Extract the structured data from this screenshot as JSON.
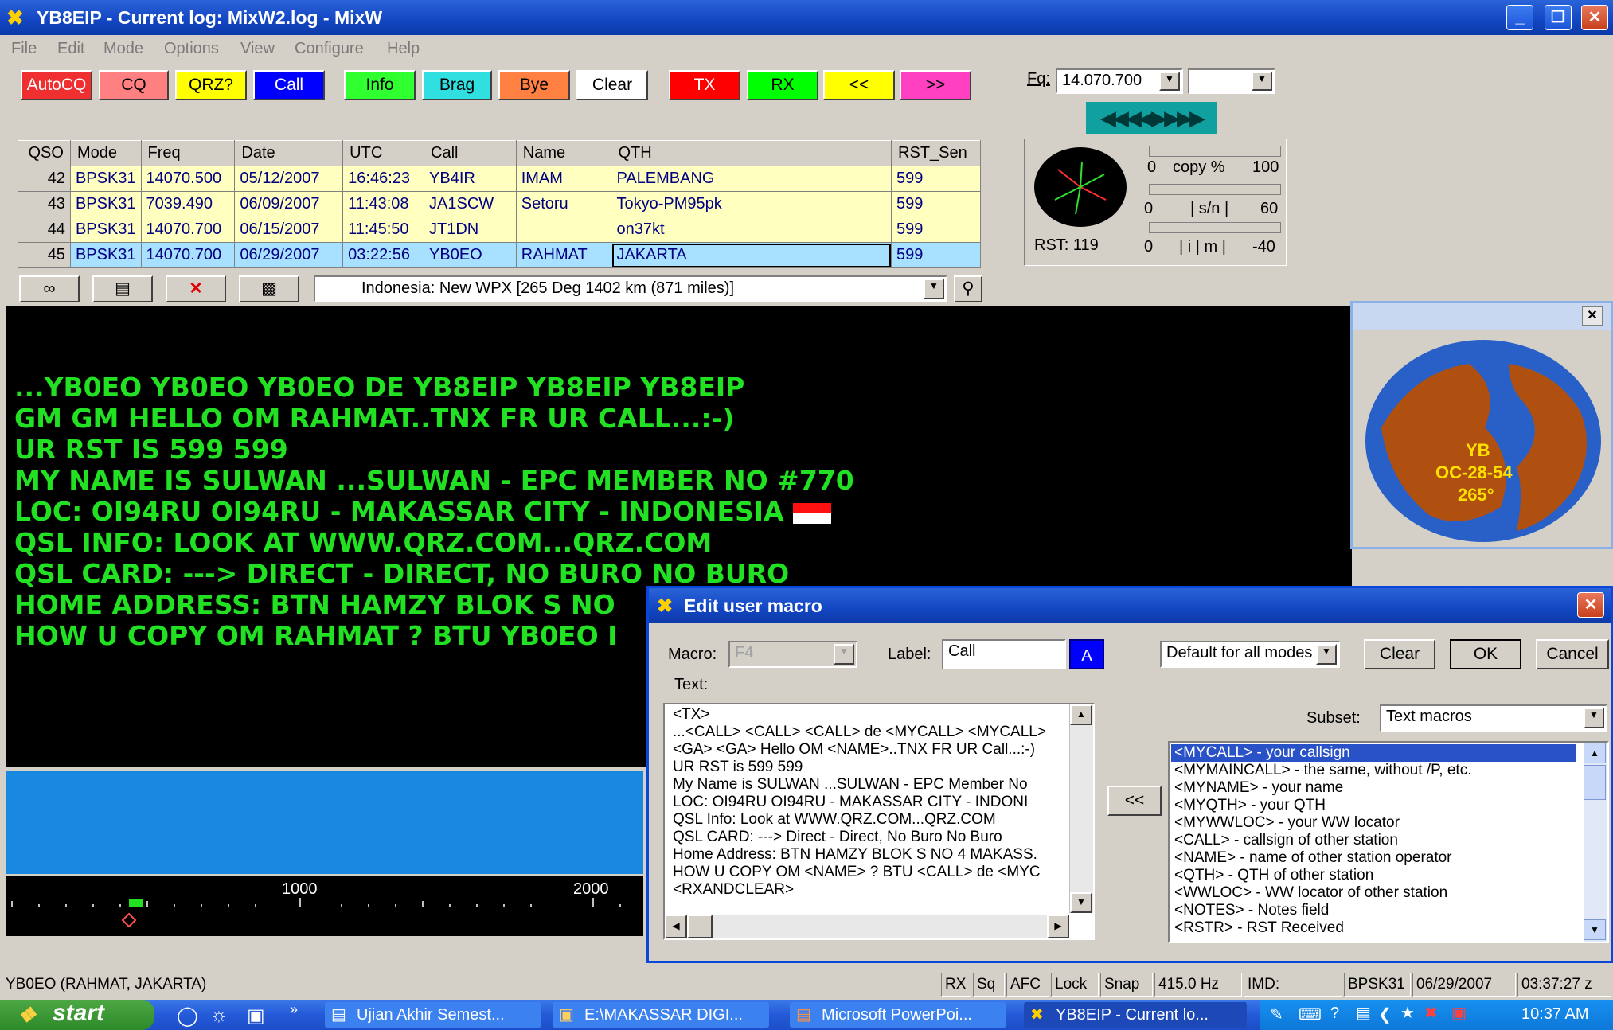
{
  "window": {
    "title": "YB8EIP - Current log: MixW2.log - MixW"
  },
  "menu": [
    "File",
    "Edit",
    "Mode",
    "Options",
    "View",
    "Configure",
    "Help"
  ],
  "macro_buttons": [
    {
      "label": "AutoCQ",
      "bg": "#f03030",
      "fg": "#ffffff"
    },
    {
      "label": "CQ",
      "bg": "#ff8080",
      "fg": "#000000"
    },
    {
      "label": "QRZ?",
      "bg": "#ffff00",
      "fg": "#000000"
    },
    {
      "label": "Call",
      "bg": "#0000ff",
      "fg": "#ffffff"
    },
    {
      "label": "Info",
      "bg": "#30ff30",
      "fg": "#000000"
    },
    {
      "label": "Brag",
      "bg": "#30e0e0",
      "fg": "#000000"
    },
    {
      "label": "Bye",
      "bg": "#ff8040",
      "fg": "#000000"
    },
    {
      "label": "Clear",
      "bg": "#ffffff",
      "fg": "#000000"
    },
    {
      "label": "TX",
      "bg": "#ff0000",
      "fg": "#ffffff"
    },
    {
      "label": "RX",
      "bg": "#00ff00",
      "fg": "#000000"
    },
    {
      "label": "<<",
      "bg": "#ffff00",
      "fg": "#000000"
    },
    {
      "label": ">>",
      "bg": "#ff40c0",
      "fg": "#000000"
    }
  ],
  "frequency": {
    "label": "Fq:",
    "value": "14.070.700",
    "second_value": ""
  },
  "tuning": {
    "copy_min": "0",
    "copy_label": "copy %",
    "copy_max": "100",
    "sn_min": "0",
    "sn_label": "| s/n |",
    "sn_max": "60",
    "imd_min": "0",
    "imd_label": "| i | m |",
    "imd_max": "-40",
    "rst": "RST: 119"
  },
  "log": {
    "headers": [
      "QSO",
      "Mode",
      "Freq",
      "Date",
      "UTC",
      "Call",
      "Name",
      "QTH",
      "RST_Sen"
    ],
    "rows": [
      [
        "42",
        "BPSK31",
        "14070.500",
        "05/12/2007",
        "16:46:23",
        "YB4IR",
        "IMAM",
        "PALEMBANG",
        "599"
      ],
      [
        "43",
        "BPSK31",
        "7039.490",
        "06/09/2007",
        "11:43:08",
        "JA1SCW",
        "Setoru",
        "Tokyo-PM95pk",
        "599"
      ],
      [
        "44",
        "BPSK31",
        "14070.700",
        "06/15/2007",
        "11:45:50",
        "JT1DN",
        "",
        "on37kt",
        "599"
      ],
      [
        "45",
        "BPSK31",
        "14070.700",
        "06/29/2007",
        "03:22:56",
        "YB0EO",
        "RAHMAT",
        "JAKARTA",
        "599"
      ]
    ]
  },
  "lookup": {
    "text": "Indonesia:  New WPX [265 Deg  1402 km (871 miles)]"
  },
  "terminal_lines": [
    "...YB0EO YB0EO YB0EO DE YB8EIP YB8EIP  YB8EIP",
    "GM GM HELLO OM RAHMAT..TNX FR UR CALL...:-)",
    "UR RST IS 599 599",
    "MY NAME IS SULWAN ...SULWAN - EPC MEMBER NO #770",
    "LOC: OI94RU  OI94RU  - MAKASSAR CITY - INDONESIA",
    "QSL INFO: LOOK AT  WWW.QRZ.COM...QRZ.COM",
    "QSL CARD: ---> DIRECT - DIRECT, NO BURO NO BURO",
    "HOME ADDRESS: BTN HAMZY BLOK S NO",
    "HOW U COPY OM RAHMAT ? BTU YB0EO I"
  ],
  "scale": {
    "mark1": "1000",
    "mark2": "2000"
  },
  "map": {
    "prefix": "YB",
    "zones": "OC-28-54",
    "bearing": "265°"
  },
  "dialog": {
    "title": "Edit user macro",
    "macro_label": "Macro:",
    "macro_value": "F4",
    "label_label": "Label:",
    "label_value": "Call",
    "color_btn": "A",
    "mode_value": "Default for all modes",
    "clear": "Clear",
    "ok": "OK",
    "cancel": "Cancel",
    "text_label": "Text:",
    "subset_label": "Subset:",
    "subset_value": "Text macros",
    "insert_btn": "<<",
    "text_lines": [
      "<TX>",
      "...<CALL> <CALL> <CALL> de <MYCALL> <MYCALL>",
      "<GA> <GA> Hello OM <NAME>..TNX FR UR Call...:-)",
      "UR RST is 599 599",
      "My Name is SULWAN ...SULWAN - EPC Member No",
      "LOC: OI94RU  OI94RU  - MAKASSAR CITY - INDONI",
      "QSL Info: Look at  WWW.QRZ.COM...QRZ.COM",
      "QSL CARD: ---> Direct - Direct, No Buro No Buro",
      "Home Address: BTN HAMZY BLOK S NO 4 MAKASS.",
      "HOW U COPY OM <NAME> ? BTU <CALL> de <MYC",
      "<RXANDCLEAR>"
    ],
    "subset_items": [
      "<MYCALL> - your callsign",
      "<MYMAINCALL> - the same, without /P, etc.",
      "<MYNAME> - your name",
      "<MYQTH> - your QTH",
      "<MYWWLOC> - your WW locator",
      "<CALL> - callsign of other station",
      "<NAME> - name of other station operator",
      "<QTH> - QTH of other station",
      "<WWLOC> - WW locator of other station",
      "<NOTES> - Notes field",
      "<RSTR> - RST Received"
    ]
  },
  "status": {
    "station": "YB0EO (RAHMAT, JAKARTA)",
    "rx": "RX",
    "sq": "Sq",
    "afc": "AFC",
    "lock": "Lock",
    "snap": "Snap",
    "hz": "415.0 Hz",
    "imd": "IMD:",
    "mode": "BPSK31",
    "date": "06/29/2007",
    "time": "03:37:27 z"
  },
  "taskbar": {
    "start": "start",
    "tasks": [
      "Ujian Akhir Semest...",
      "E:\\MAKASSAR DIGI...",
      "Microsoft PowerPoi...",
      "YB8EIP - Current lo..."
    ],
    "clock": "10:37 AM"
  }
}
